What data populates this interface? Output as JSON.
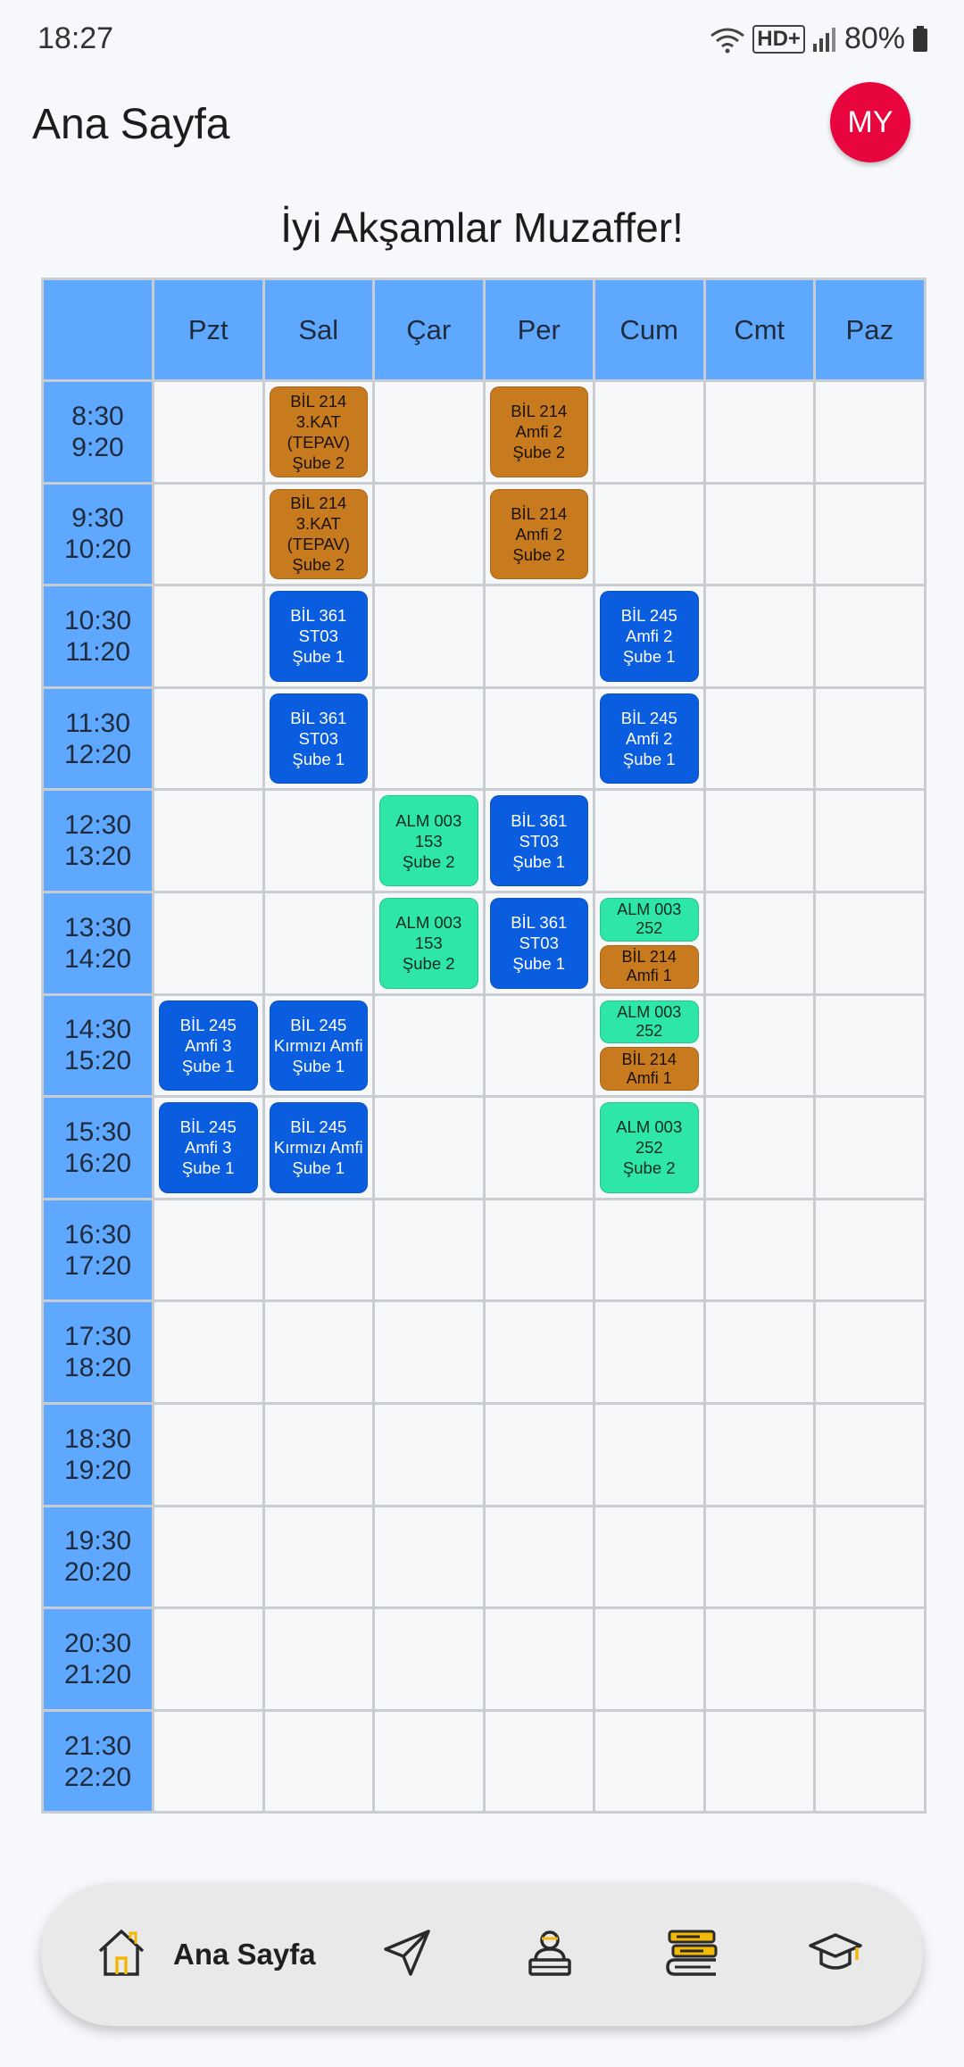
{
  "status_bar": {
    "time": "18:27",
    "network_label": "HD+",
    "battery": "80%"
  },
  "header": {
    "title": "Ana Sayfa",
    "avatar_initials": "MY"
  },
  "greeting": "İyi Akşamlar Muzaffer!",
  "colors": {
    "orange": "#c77a1e",
    "blue": "#0b5de0",
    "teal": "#2ee6a8",
    "header_blue": "#5fa8ff",
    "avatar_red": "#e8053d"
  },
  "timetable": {
    "days": [
      "Pzt",
      "Sal",
      "Çar",
      "Per",
      "Cum",
      "Cmt",
      "Paz"
    ],
    "slots": [
      {
        "start": "8:30",
        "end": "9:20"
      },
      {
        "start": "9:30",
        "end": "10:20"
      },
      {
        "start": "10:30",
        "end": "11:20"
      },
      {
        "start": "11:30",
        "end": "12:20"
      },
      {
        "start": "12:30",
        "end": "13:20"
      },
      {
        "start": "13:30",
        "end": "14:20"
      },
      {
        "start": "14:30",
        "end": "15:20"
      },
      {
        "start": "15:30",
        "end": "16:20"
      },
      {
        "start": "16:30",
        "end": "17:20"
      },
      {
        "start": "17:30",
        "end": "18:20"
      },
      {
        "start": "18:30",
        "end": "19:20"
      },
      {
        "start": "19:30",
        "end": "20:20"
      },
      {
        "start": "20:30",
        "end": "21:20"
      },
      {
        "start": "21:30",
        "end": "22:20"
      }
    ],
    "entries": [
      {
        "day": 1,
        "slot": 0,
        "color": "orange",
        "lines": [
          "BİL 214",
          "3.KAT",
          "(TEPAV)",
          "Şube 2"
        ]
      },
      {
        "day": 3,
        "slot": 0,
        "color": "orange",
        "lines": [
          "BİL 214",
          "Amfi 2",
          "Şube 2"
        ]
      },
      {
        "day": 1,
        "slot": 1,
        "color": "orange",
        "lines": [
          "BİL 214",
          "3.KAT",
          "(TEPAV)",
          "Şube 2"
        ]
      },
      {
        "day": 3,
        "slot": 1,
        "color": "orange",
        "lines": [
          "BİL 214",
          "Amfi 2",
          "Şube 2"
        ]
      },
      {
        "day": 1,
        "slot": 2,
        "color": "blue",
        "lines": [
          "BİL 361",
          "ST03",
          "Şube 1"
        ]
      },
      {
        "day": 4,
        "slot": 2,
        "color": "blue",
        "lines": [
          "BİL 245",
          "Amfi 2",
          "Şube 1"
        ]
      },
      {
        "day": 1,
        "slot": 3,
        "color": "blue",
        "lines": [
          "BİL 361",
          "ST03",
          "Şube 1"
        ]
      },
      {
        "day": 4,
        "slot": 3,
        "color": "blue",
        "lines": [
          "BİL 245",
          "Amfi 2",
          "Şube 1"
        ]
      },
      {
        "day": 2,
        "slot": 4,
        "color": "teal",
        "lines": [
          "ALM 003",
          "153",
          "Şube 2"
        ]
      },
      {
        "day": 3,
        "slot": 4,
        "color": "blue",
        "lines": [
          "BİL 361",
          "ST03",
          "Şube 1"
        ]
      },
      {
        "day": 2,
        "slot": 5,
        "color": "teal",
        "lines": [
          "ALM 003",
          "153",
          "Şube 2"
        ]
      },
      {
        "day": 3,
        "slot": 5,
        "color": "blue",
        "lines": [
          "BİL 361",
          "ST03",
          "Şube 1"
        ]
      },
      {
        "day": 4,
        "slot": 5,
        "color": "teal",
        "lines": [
          "ALM 003",
          "252"
        ]
      },
      {
        "day": 4,
        "slot": 5,
        "color": "orange",
        "lines": [
          "BİL 214",
          "Amfi 1"
        ]
      },
      {
        "day": 0,
        "slot": 6,
        "color": "blue",
        "lines": [
          "BİL 245",
          "Amfi 3",
          "Şube 1"
        ]
      },
      {
        "day": 1,
        "slot": 6,
        "color": "blue",
        "lines": [
          "BİL 245",
          "Kırmızı Amfi",
          "Şube 1"
        ]
      },
      {
        "day": 4,
        "slot": 6,
        "color": "teal",
        "lines": [
          "ALM 003",
          "252"
        ]
      },
      {
        "day": 4,
        "slot": 6,
        "color": "orange",
        "lines": [
          "BİL 214",
          "Amfi 1"
        ]
      },
      {
        "day": 0,
        "slot": 7,
        "color": "blue",
        "lines": [
          "BİL 245",
          "Amfi 3",
          "Şube 1"
        ]
      },
      {
        "day": 1,
        "slot": 7,
        "color": "blue",
        "lines": [
          "BİL 245",
          "Kırmızı Amfi",
          "Şube 1"
        ]
      },
      {
        "day": 4,
        "slot": 7,
        "color": "teal",
        "lines": [
          "ALM 003",
          "252",
          "Şube 2"
        ]
      }
    ]
  },
  "bottom_nav": {
    "items": [
      {
        "name": "home",
        "label": "Ana Sayfa",
        "icon": "home-icon",
        "active": true
      },
      {
        "name": "send",
        "icon": "send-icon"
      },
      {
        "name": "teacher",
        "icon": "teacher-icon"
      },
      {
        "name": "courses",
        "icon": "books-icon"
      },
      {
        "name": "graduation",
        "icon": "graduation-cap-icon"
      }
    ]
  }
}
